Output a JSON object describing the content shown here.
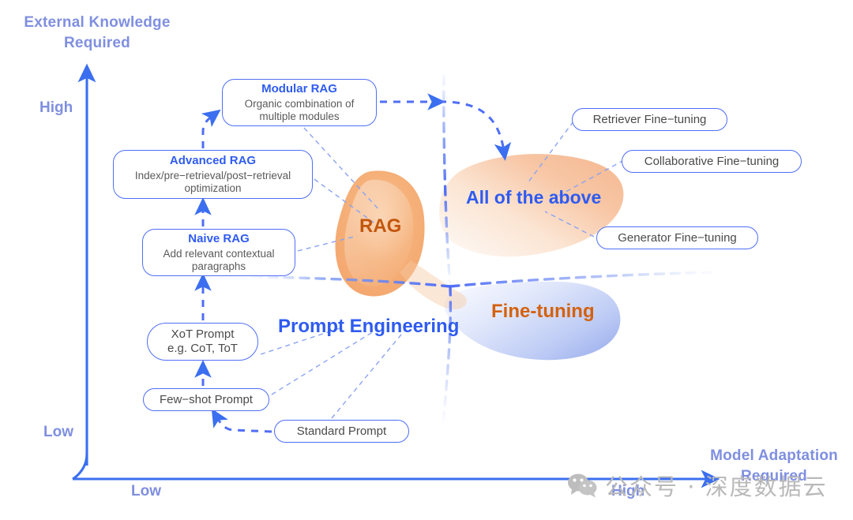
{
  "axes": {
    "y_title": "External Knowledge\nRequired",
    "y_title_line1": "External Knowledge",
    "y_title_line2": "Required",
    "x_title_line1": "Model Adaptation",
    "x_title_line2": "Required",
    "y_high": "High",
    "y_low": "Low",
    "x_low": "Low",
    "x_high": "High",
    "axis_color": "#3b6ff0",
    "label_color": "#7f8fe0"
  },
  "nodes": {
    "modular_rag": {
      "title": "Modular RAG",
      "subtitle": "Organic combination of\nmultiple modules",
      "sub_line1": "Organic combination of",
      "sub_line2": "multiple modules"
    },
    "advanced_rag": {
      "title": "Advanced RAG",
      "sub_line1": "Index/pre−retrieval/post−retrieval",
      "sub_line2": "optimization"
    },
    "naive_rag": {
      "title": "Naive RAG",
      "sub_line1": "Add relevant contextual",
      "sub_line2": "paragraphs"
    },
    "xot_prompt": {
      "line1": "XoT Prompt",
      "line2": "e.g. CoT, ToT"
    },
    "few_shot_prompt": {
      "label": "Few−shot Prompt"
    },
    "standard_prompt": {
      "label": "Standard Prompt"
    },
    "retriever_ft": {
      "label": "Retriever Fine−tuning"
    },
    "collaborative_ft": {
      "label": "Collaborative Fine−tuning"
    },
    "generator_ft": {
      "label": "Generator Fine−tuning"
    }
  },
  "regions": {
    "rag": {
      "label": "RAG",
      "color": "#c2560e",
      "fill": "#f4a86a"
    },
    "fine_tuning": {
      "label": "Fine-tuning",
      "color": "#d4610f",
      "fill": "#9db2f0"
    },
    "all_of_the_above": {
      "label": "All of the above",
      "color": "#2f5bf0",
      "fill": "#f6b890"
    },
    "prompt_engineering": {
      "label": "Prompt Engineering",
      "color": "#2f5bf0"
    }
  },
  "watermark": {
    "text": "公众号 · 深度数据云",
    "icon": "wechat-icon",
    "color": "#b9b9b9"
  },
  "chart_data": {
    "type": "scatter",
    "title": "",
    "xlabel": "Model Adaptation Required",
    "ylabel": "External Knowledge Required",
    "xticks": [
      "Low",
      "High"
    ],
    "yticks": [
      "Low",
      "High"
    ],
    "grid": false,
    "legend": "none",
    "annotations": [
      {
        "text": "Prompt Engineering",
        "quadrant": "low-x / low-y"
      },
      {
        "text": "RAG",
        "quadrant": "low-x / high-y"
      },
      {
        "text": "Fine-tuning",
        "quadrant": "high-x / low-y"
      },
      {
        "text": "All of the above",
        "quadrant": "high-x / high-y"
      }
    ]
  }
}
